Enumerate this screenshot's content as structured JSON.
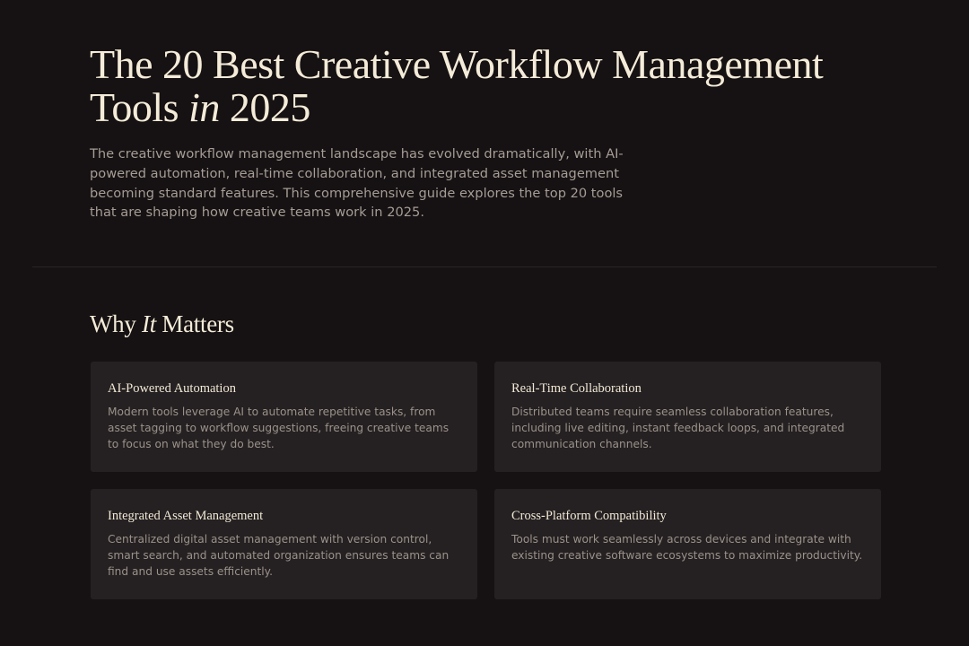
{
  "hero": {
    "title_main": "The 20 Best Creative Workflow Management Tools ",
    "title_italic": "in",
    "title_end": " 2025",
    "intro": "The creative workflow management landscape has evolved dramatically, with AI-powered automation, real-time collaboration, and integrated asset management becoming standard features. This comprehensive guide explores the top 20 tools that are shaping how creative teams work in 2025."
  },
  "section": {
    "title_start": "Why ",
    "title_italic": "It",
    "title_end": " Matters"
  },
  "cards": [
    {
      "title": "AI-Powered Automation",
      "text": "Modern tools leverage AI to automate repetitive tasks, from asset tagging to workflow suggestions, freeing creative teams to focus on what they do best."
    },
    {
      "title": "Real-Time Collaboration",
      "text": "Distributed teams require seamless collaboration features, including live editing, instant feedback loops, and integrated communication channels."
    },
    {
      "title": "Integrated Asset Management",
      "text": "Centralized digital asset management with version control, smart search, and automated organization ensures teams can find and use assets efficiently."
    },
    {
      "title": "Cross-Platform Compatibility",
      "text": "Tools must work seamlessly across devices and integrate with existing creative software ecosystems to maximize productivity."
    }
  ],
  "colors": {
    "background": "#161112",
    "card_background": "#252021",
    "heading": "#f4ecd9",
    "body_text": "#a59d96"
  }
}
